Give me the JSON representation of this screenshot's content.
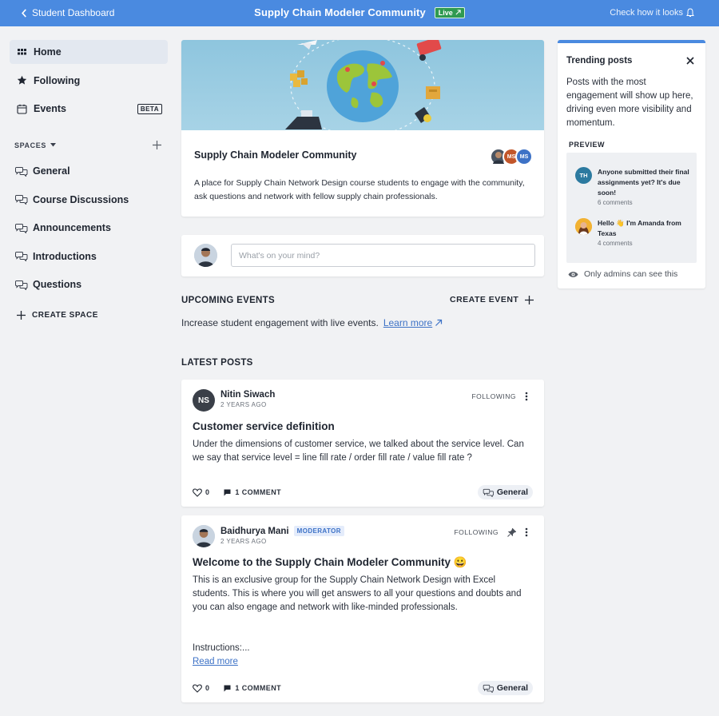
{
  "topbar": {
    "back_label": "Student Dashboard",
    "title": "Supply Chain Modeler Community",
    "live_label": "Live",
    "right_label": "Check how it looks"
  },
  "sidebar": {
    "items": [
      {
        "label": "Home",
        "icon": "grid-icon"
      },
      {
        "label": "Following",
        "icon": "star-icon"
      },
      {
        "label": "Events",
        "icon": "calendar-icon",
        "badge": "BETA"
      }
    ],
    "spaces_label": "SPACES",
    "spaces": [
      {
        "label": "General"
      },
      {
        "label": "Course Discussions"
      },
      {
        "label": "Announcements"
      },
      {
        "label": "Introductions"
      },
      {
        "label": "Questions"
      }
    ],
    "create_space_label": "CREATE SPACE"
  },
  "community": {
    "name": "Supply Chain Modeler Community",
    "description": "A place for Supply Chain Network Design course students to engage with the community, ask questions and network with fellow supply chain professionals.",
    "member_initials": [
      "MS",
      "MS"
    ]
  },
  "composer": {
    "placeholder": "What's on your mind?"
  },
  "events": {
    "title": "UPCOMING EVENTS",
    "create_label": "CREATE EVENT",
    "text": "Increase student engagement with live events.",
    "learn_more": "Learn more"
  },
  "latest": {
    "title": "LATEST POSTS",
    "posts": [
      {
        "initials": "NS",
        "author": "Nitin Siwach",
        "time": "2 YEARS AGO",
        "following": "FOLLOWING",
        "title": "Customer service definition",
        "body": "Under the dimensions of customer service, we talked about the service level. Can we say that service level = line fill rate / order fill rate / value fill rate ?",
        "likes": "0",
        "comments": "1 COMMENT",
        "space": "General"
      },
      {
        "author": "Baidhurya Mani",
        "badge": "MODERATOR",
        "time": "2 YEARS AGO",
        "following": "FOLLOWING",
        "title": "Welcome to the Supply Chain Modeler Community 😀",
        "body": "This is an exclusive group for the Supply Chain Network Design with Excel students. This is where you will get answers to all your questions and doubts and you can also engage and network with like-minded professionals.",
        "instructions": "Instructions:...",
        "read_more": "Read more",
        "likes": "0",
        "comments": "1 COMMENT",
        "space": "General"
      }
    ]
  },
  "trending": {
    "title": "Trending posts",
    "description": "Posts with the most engagement will show up here, driving even more visibility and momentum.",
    "preview_label": "PREVIEW",
    "posts": [
      {
        "initials": "TH",
        "title": "Anyone submitted their final assignments yet? It's due soon!",
        "count": "6 comments"
      },
      {
        "title": "Hello 👋 I'm Amanda from Texas",
        "count": "4 comments"
      }
    ],
    "admins_note": "Only admins can see this"
  },
  "colors": {
    "accent": "#4a8ae0",
    "live_green": "#2f9a51",
    "link": "#3d72c6"
  }
}
